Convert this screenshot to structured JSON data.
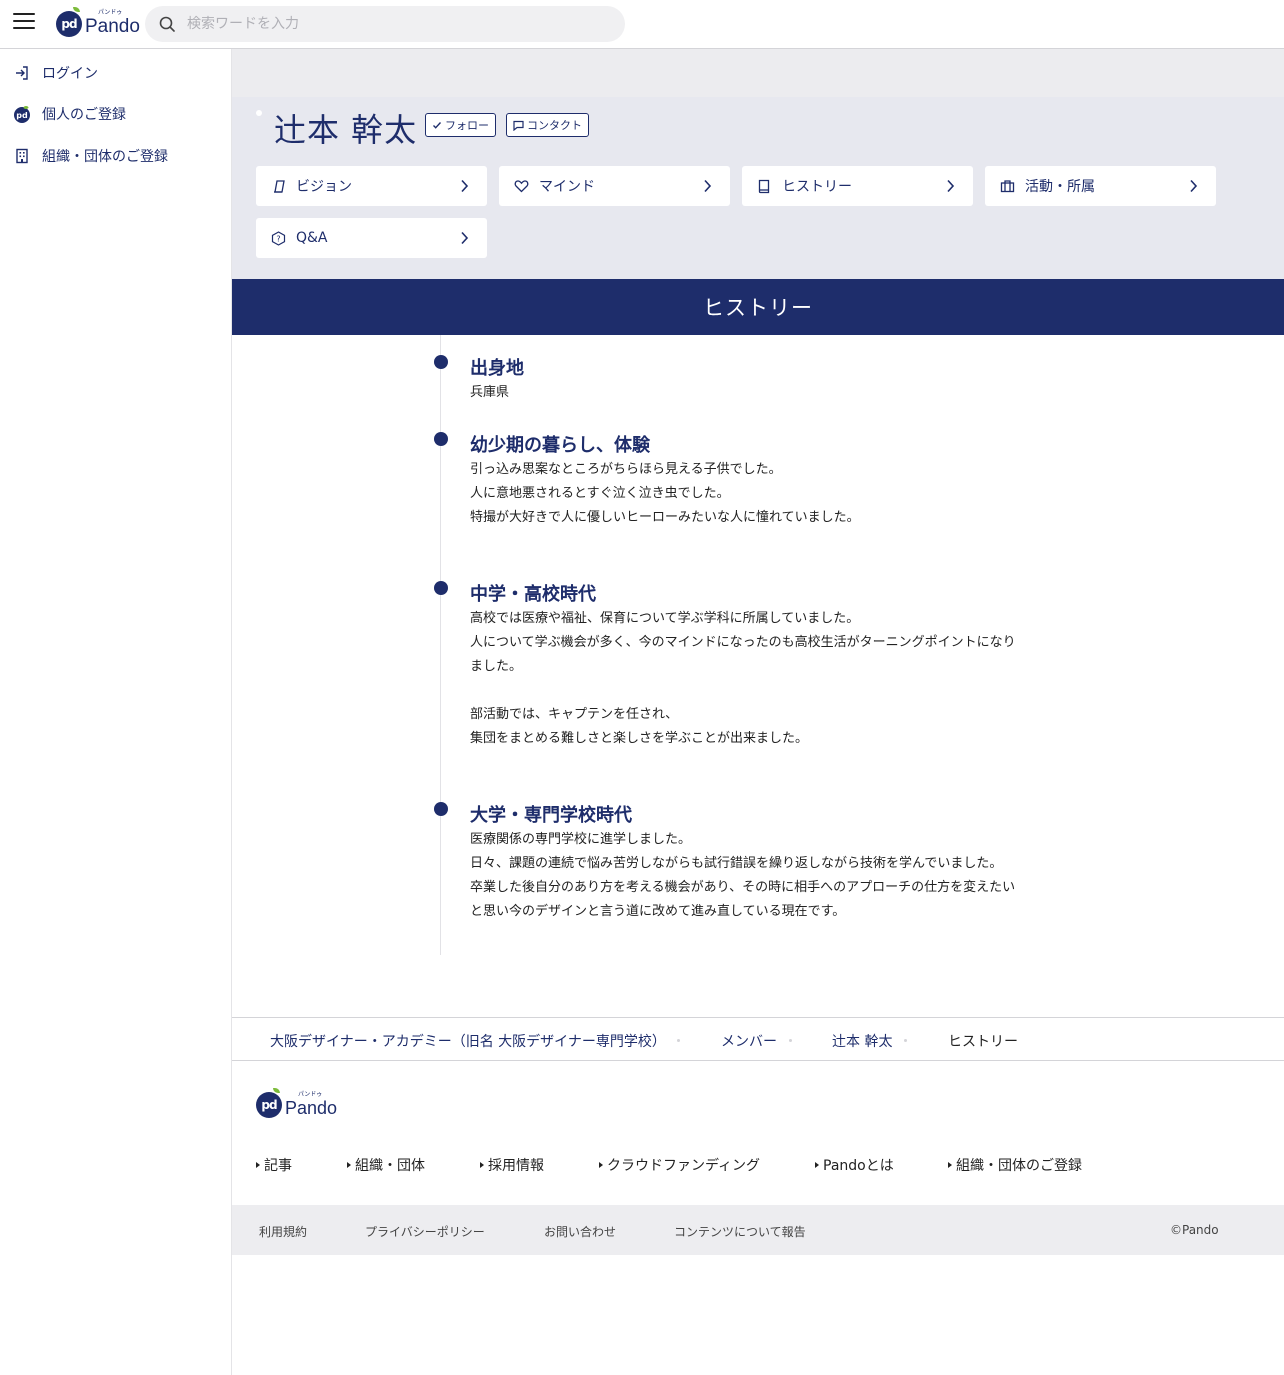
{
  "header": {
    "logo_text": "Pando",
    "logo_ruby": "パンドゥ",
    "logo_badge": "pd",
    "search_placeholder": "検索ワードを入力"
  },
  "sidebar": {
    "items": [
      {
        "label": "ログイン",
        "icon": "login-icon"
      },
      {
        "label": "個人のご登録",
        "icon": "pando-logo-icon"
      },
      {
        "label": "組織・団体のご登録",
        "icon": "building-icon"
      }
    ]
  },
  "profile": {
    "name": "辻本 幹太",
    "follow_label": "フォロー",
    "contact_label": "コンタクト",
    "nav": [
      {
        "label": "ビジョン",
        "icon": "pen-icon"
      },
      {
        "label": "マインド",
        "icon": "heart-icon"
      },
      {
        "label": "ヒストリー",
        "icon": "book-icon"
      },
      {
        "label": "活動・所属",
        "icon": "briefcase-icon"
      },
      {
        "label": "Q&A",
        "icon": "question-icon"
      }
    ]
  },
  "section_title": "ヒストリー",
  "history": [
    {
      "heading": "出身地",
      "lines": [
        "兵庫県"
      ]
    },
    {
      "heading": "幼少期の暮らし、体験",
      "lines": [
        "引っ込み思案なところがちらほら見える子供でした。",
        "人に意地悪されるとすぐ泣く泣き虫でした。",
        "特撮が大好きで人に優しいヒーローみたいな人に憧れていました。"
      ]
    },
    {
      "heading": "中学・高校時代",
      "lines": [
        "高校では医療や福祉、保育について学ぶ学科に所属していました。",
        "人について学ぶ機会が多く、今のマインドになったのも高校生活がターニングポイントになり",
        "ました。",
        "",
        "部活動では、キャプテンを任され、",
        "集団をまとめる難しさと楽しさを学ぶことが出来ました。"
      ]
    },
    {
      "heading": "大学・専門学校時代",
      "lines": [
        "医療関係の専門学校に進学しました。",
        "日々、課題の連続で悩み苦労しながらも試行錯誤を繰り返しながら技術を学んでいました。",
        "卒業した後自分のあり方を考える機会があり、その時に相手へのアプローチの仕方を変えたい",
        "と思い今のデザインと言う道に改めて進み直している現在です。"
      ]
    }
  ],
  "breadcrumb": [
    "大阪デザイナー・アカデミー（旧名 大阪デザイナー専門学校）",
    "メンバー",
    "辻本 幹太",
    "ヒストリー"
  ],
  "footer": {
    "logo_text": "Pando",
    "links": [
      "記事",
      "組織・団体",
      "採用情報",
      "クラウドファンディング",
      "Pandoとは",
      "組織・団体のご登録"
    ],
    "bottom": [
      "利用規約",
      "プライバシーポリシー",
      "お問い合わせ",
      "コンテンツについて報告"
    ],
    "copyright": "©Pando"
  },
  "colors": {
    "brand_navy": "#1e2d6b",
    "band_bg": "#e7e8ef",
    "leaf_green": "#7cbb3a"
  }
}
